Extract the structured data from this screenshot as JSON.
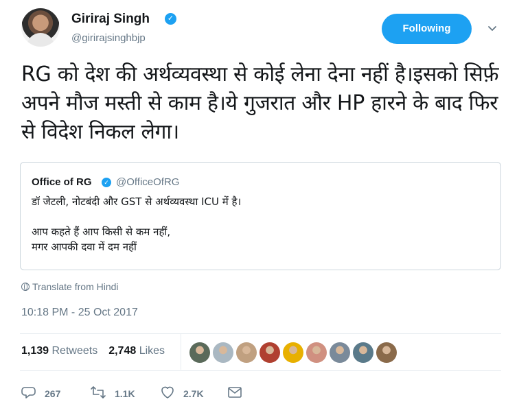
{
  "author": {
    "display_name": "Giriraj Singh",
    "handle": "@girirajsinghbjp",
    "verified": true,
    "verified_glyph": "✓"
  },
  "follow_button": {
    "label": "Following"
  },
  "tweet": {
    "text": "RG को देश की अर्थव्यवस्था से कोई लेना देना नहीं है।इसको सिर्फ़ अपने मौज मस्ती से काम है।ये गुजरात और HP हारने के बाद फिर से विदेश निकल लेगा।"
  },
  "quoted_tweet": {
    "display_name": "Office of RG",
    "handle": "@OfficeOfRG",
    "verified_glyph": "✓",
    "text": "डॉ जेटली, नोटबंदी और GST से अर्थव्यवस्था ICU में है।\n\nआप कहते हैं आप किसी से कम नहीं,\nमगर आपकी दवा में दम नहीं"
  },
  "translate": {
    "label": "Translate from Hindi",
    "icon": "globe-icon"
  },
  "timestamp": "10:18 PM - 25 Oct 2017",
  "stats": {
    "retweets_count": "1,139",
    "retweets_label": "Retweets",
    "likes_count": "2,748",
    "likes_label": "Likes"
  },
  "likers": [
    {
      "color": "#5a6a5a"
    },
    {
      "color": "#aab8c2"
    },
    {
      "color": "#c0a080"
    },
    {
      "color": "#b04030"
    },
    {
      "color": "#e8b000"
    },
    {
      "color": "#d09080"
    },
    {
      "color": "#7a8a9a"
    },
    {
      "color": "#5a7a8a"
    },
    {
      "color": "#8a6a4a"
    }
  ],
  "actions": {
    "replies": {
      "count": "267",
      "icon": "reply-icon"
    },
    "retweets": {
      "count": "1.1K",
      "icon": "retweet-icon"
    },
    "likes": {
      "count": "2.7K",
      "icon": "heart-icon"
    },
    "dm": {
      "icon": "envelope-icon"
    }
  },
  "colors": {
    "accent": "#1da1f2",
    "secondary_text": "#657786",
    "primary_text": "#14171a",
    "border": "#ccd6dd"
  }
}
